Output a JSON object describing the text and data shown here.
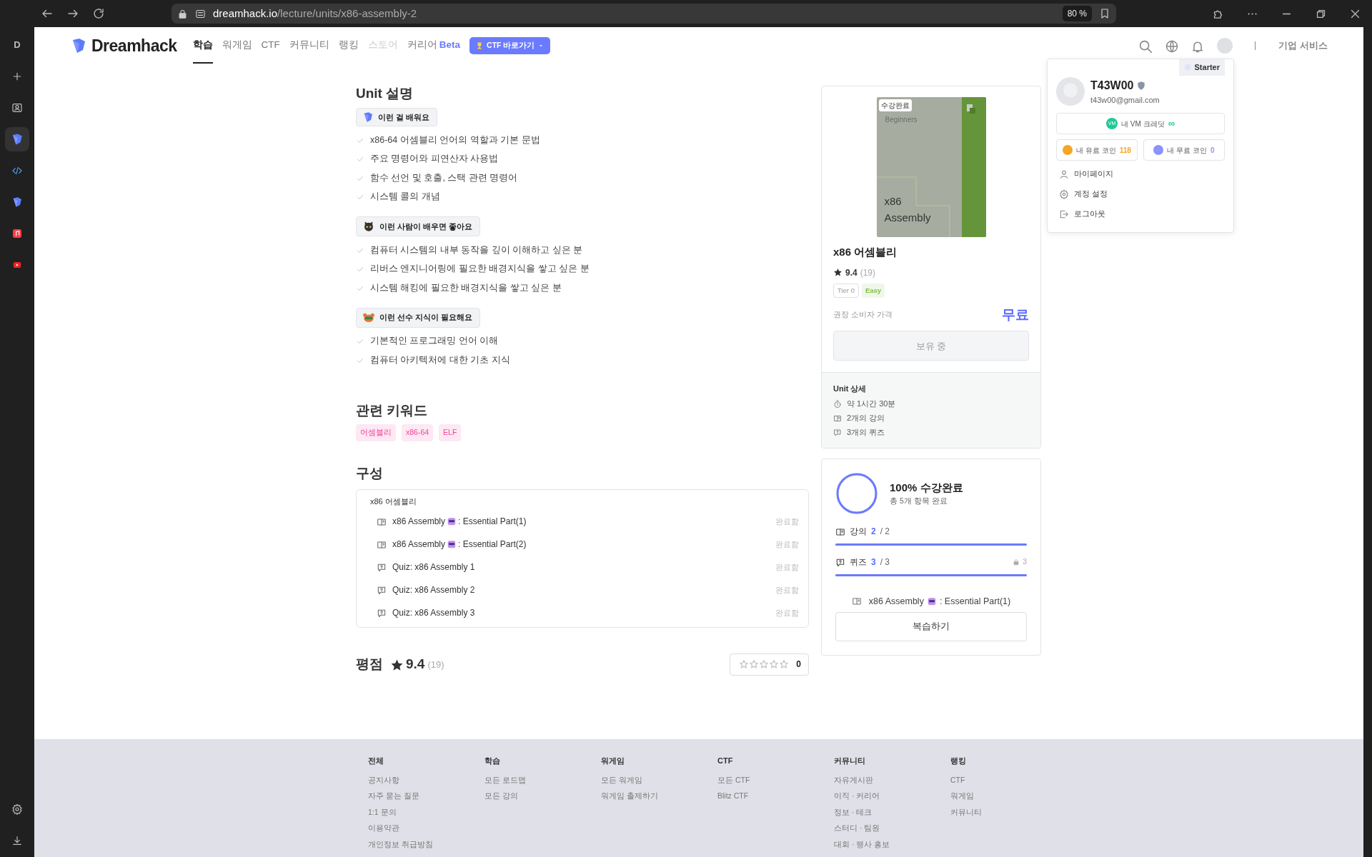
{
  "browser": {
    "sidebar_letter": "D",
    "url_host": "dreamhack.io",
    "url_path": "/lecture/units/x86-assembly-2",
    "zoom": "80 %"
  },
  "nav": {
    "logo": "Dreamhack",
    "items": [
      {
        "label": "학습",
        "selected": true,
        "disabled": false
      },
      {
        "label": "워게임",
        "selected": false,
        "disabled": false
      },
      {
        "label": "CTF",
        "selected": false,
        "disabled": false
      },
      {
        "label": "커뮤니티",
        "selected": false,
        "disabled": false
      },
      {
        "label": "랭킹",
        "selected": false,
        "disabled": false
      },
      {
        "label": "스토어",
        "selected": false,
        "disabled": true
      },
      {
        "label": "커리어",
        "selected": false,
        "disabled": false,
        "badge": "Beta"
      }
    ],
    "ctf_button": "CTF 바로가기",
    "corporate": "기업 서비스"
  },
  "account_menu": {
    "plan": "Starter",
    "username": "T43W00",
    "email": "t43w00@gmail.com",
    "vm_badge": "VM",
    "vm_label": "내 VM 크레딧",
    "vm_value": "∞",
    "coins": [
      {
        "label": "내 유료 코인",
        "value": "118",
        "color": "#f5a623"
      },
      {
        "label": "내 무료 코인",
        "value": "0",
        "color": "#8b93ff"
      }
    ],
    "items": [
      {
        "kind": "user",
        "label": "마이페이지"
      },
      {
        "kind": "gear",
        "label": "계정 설정"
      },
      {
        "kind": "logout",
        "label": "로그아웃"
      }
    ]
  },
  "unit_description": {
    "title": "Unit 설명",
    "groups": [
      {
        "heading": "이런 걸 배워요",
        "items": [
          "x86-64 어셈블리 언어의 역할과 기본 문법",
          "주요 명령어와 피연산자 사용법",
          "함수 선언 및 호출, 스택 관련 명령어",
          "시스템 콜의 개념"
        ]
      },
      {
        "heading": "이런 사람이 배우면 좋아요",
        "items": [
          "컴퓨터 시스템의 내부 동작을 깊이 이해하고 싶은 분",
          "리버스 엔지니어링에 필요한 배경지식을 쌓고 싶은 분",
          "시스템 해킹에 필요한 배경지식을 쌓고 싶은 분"
        ]
      },
      {
        "heading": "이런 선수 지식이 필요해요",
        "items": [
          "기본적인 프로그래밍 언어 이해",
          "컴퓨터 아키텍처에 대한 기초 지식"
        ]
      }
    ]
  },
  "keywords": {
    "title": "관련 키워드",
    "tags": [
      "어셈블리",
      "x86-64",
      "ELF"
    ]
  },
  "composition": {
    "title": "구성",
    "unit": "x86 어셈블리",
    "items": [
      {
        "kind": "lecture",
        "title": "x86 Assembly",
        "title_rest": ": Essential Part(1)",
        "status": "완료함"
      },
      {
        "kind": "lecture",
        "title": "x86 Assembly",
        "title_rest": ": Essential Part(2)",
        "status": "완료함"
      },
      {
        "kind": "quiz",
        "title": "Quiz: x86 Assembly 1",
        "status": "완료함"
      },
      {
        "kind": "quiz",
        "title": "Quiz: x86 Assembly 2",
        "status": "완료함"
      },
      {
        "kind": "quiz",
        "title": "Quiz: x86 Assembly 3",
        "status": "완료함"
      }
    ]
  },
  "rating": {
    "title": "평점",
    "score": "9.4",
    "count": "(19)",
    "stars": 0,
    "my_score": "0"
  },
  "course_card": {
    "thumb_badge": "수강완료",
    "thumb_series": "Beginners",
    "thumb_title": "x86 Assembly",
    "title": "x86 어셈블리",
    "score": "9.4",
    "count": "(19)",
    "tier": "Tier 0",
    "difficulty": "Easy",
    "price_label": "권장 소비자 가격",
    "price": "무료",
    "button": "보유 중",
    "button_disabled": true,
    "details_title": "Unit 상세",
    "details": [
      {
        "kind": "time",
        "text": "약 1시간 30분"
      },
      {
        "kind": "lecture",
        "text": "2개의 강의"
      },
      {
        "kind": "quiz",
        "text": "3개의 퀴즈"
      }
    ]
  },
  "progress": {
    "level": 1,
    "title": "100% 수강완료",
    "subtitle": "총 5개 항목 완료",
    "rows": [
      {
        "kind": "lecture",
        "label": "강의",
        "done": "2",
        "total": "/ 2",
        "level": 1
      },
      {
        "kind": "quiz",
        "label": "퀴즈",
        "done": "3",
        "total": "/ 3",
        "locked": "3",
        "level": 1
      }
    ],
    "next_title": "x86 Assembly",
    "next_title_rest": ": Essential Part(1)",
    "button": "복습하기"
  },
  "footer": {
    "columns": [
      {
        "heading": "전체",
        "links": [
          "공지사항",
          "자주 묻는 질문",
          "1:1 문의",
          "이용약관",
          "개인정보 취급방침"
        ]
      },
      {
        "heading": "학습",
        "links": [
          "모든 로드맵",
          "모든 강의"
        ]
      },
      {
        "heading": "워게임",
        "links": [
          "모든 워게임",
          "워게임 출제하기"
        ]
      },
      {
        "heading": "CTF",
        "links": [
          "모든 CTF",
          "Blitz CTF"
        ]
      },
      {
        "heading": "커뮤니티",
        "links": [
          "자유게시판",
          "이직 · 커리어",
          "정보 · 테크",
          "스터디 · 팀원",
          "대회 · 행사 홍보"
        ]
      },
      {
        "heading": "랭킹",
        "links": [
          "CTF",
          "워게임",
          "커뮤니티"
        ]
      }
    ]
  }
}
